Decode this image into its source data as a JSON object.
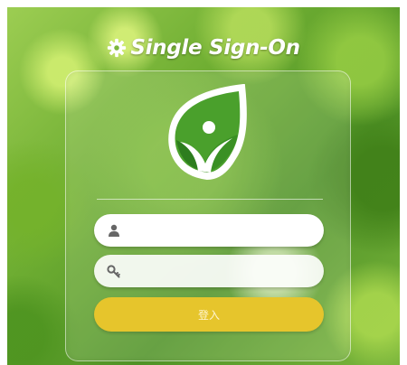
{
  "header": {
    "title": "Single Sign-On",
    "icon": "gear-icon"
  },
  "logo": {
    "icon": "leaf-person-logo",
    "colors": {
      "green": "#4aa02c",
      "dark_green": "#2d7d1e",
      "white": "#ffffff"
    }
  },
  "form": {
    "username": {
      "icon": "user-icon",
      "value": "",
      "placeholder": ""
    },
    "password": {
      "icon": "key-icon",
      "value": "",
      "placeholder": ""
    },
    "login_label": "登入"
  },
  "colors": {
    "button": "#e6c52c",
    "background_green": "#6fae32"
  }
}
